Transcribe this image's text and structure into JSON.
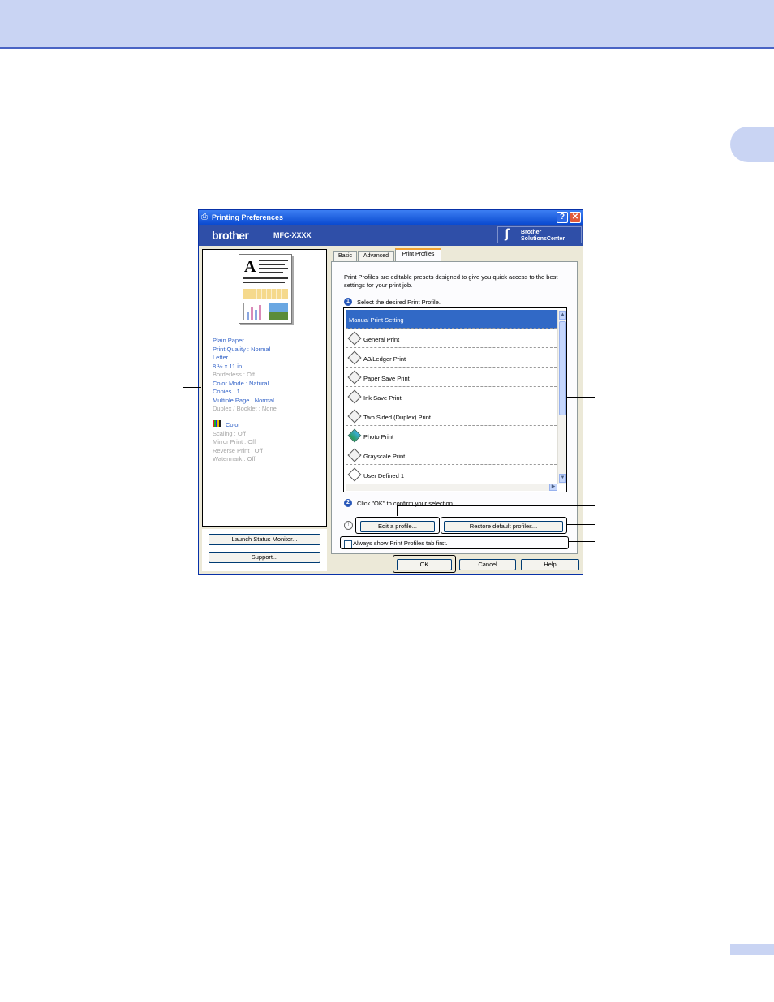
{
  "dialog": {
    "title": "Printing Preferences",
    "help_btn": "?",
    "close_btn": "✕",
    "brand": "brother",
    "model": "MFC-XXXX",
    "solutions_line1": "Brother",
    "solutions_line2": "SolutionsCenter"
  },
  "settings": {
    "blue": [
      "Plain Paper",
      "Print Quality : Normal",
      "Letter",
      "8 ½ x 11 in",
      "Color Mode : Natural",
      "Copies : 1",
      "Multiple Page : Normal"
    ],
    "borderless": "Borderless : Off",
    "duplex": "Duplex / Booklet : None",
    "color": "Color",
    "grey": [
      "Scaling : Off",
      "Mirror Print : Off",
      "Reverse Print : Off",
      "Watermark : Off"
    ]
  },
  "left_buttons": {
    "launch": "Launch Status Monitor...",
    "support": "Support..."
  },
  "tabs": [
    "Basic",
    "Advanced",
    "Print Profiles"
  ],
  "profiles": {
    "description": "Print Profiles are editable presets designed to give you quick access to the best settings for your print job.",
    "step1_num": "1",
    "step1": "Select the desired Print Profile.",
    "items": [
      "Manual Print Setting",
      "General Print",
      "A3/Ledger Print",
      "Paper Save Print",
      "Ink Save Print",
      "Two Sided (Duplex) Print",
      "Photo Print",
      "Grayscale Print",
      "User Defined 1"
    ],
    "step2_num": "2",
    "step2": "Click \"OK\" to confirm your selection.",
    "edit": "Edit a profile...",
    "restore": "Restore default profiles...",
    "always_show": "Always show Print Profiles tab first.",
    "hint_icon": "!"
  },
  "footer": {
    "ok": "OK",
    "cancel": "Cancel",
    "help": "Help"
  },
  "colors": {
    "titlebar": "#0a4ad0",
    "brandbar": "#2f4fa8",
    "selection": "#3169c6",
    "header_band": "#c9d4f3"
  }
}
